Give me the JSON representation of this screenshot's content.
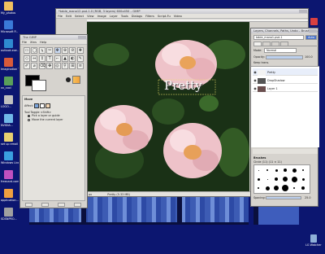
{
  "desktop": {
    "icons_left": [
      {
        "label": "My_photos"
      },
      {
        "label": "Microsoft P..."
      },
      {
        "label": "outlook.exe..."
      },
      {
        "label": "Imagination Thumbs"
      },
      {
        "label": "xx_cool"
      },
      {
        "label": "LOGO..."
      },
      {
        "label": "NVIDIA..."
      },
      {
        "label": "set up email for beginners"
      },
      {
        "label": "Windows Live..."
      },
      {
        "label": "freecard.com Windows ..."
      },
      {
        "label": "application..."
      },
      {
        "label": "SDSNPRO..."
      }
    ],
    "icons_right": [
      {
        "label": "..."
      },
      {
        "label": "..."
      },
      {
        "label": "..."
      },
      {
        "label": "..."
      },
      {
        "label": "..."
      },
      {
        "label": "..."
      }
    ],
    "recycle_label": "LG Watcher"
  },
  "image_window": {
    "title": "*table_mana12.psd-1.0 (RGB, 3 layers) 600x450 – GIMP",
    "menus": [
      "File",
      "Edit",
      "Select",
      "View",
      "Image",
      "Layer",
      "Tools",
      "Dialogs",
      "Filters",
      "Script-Fu",
      "Video"
    ],
    "canvas_text": "Pretty",
    "status": "px",
    "status_info": "Pretty (5.33 MB)"
  },
  "toolbox": {
    "title": "The GIMP",
    "menus": [
      "File",
      "Xtns",
      "Help"
    ],
    "tool_glyphs": [
      "▭",
      "◯",
      "ϡ",
      "✂",
      "✥",
      "⊕",
      "⊘",
      "✚",
      "◇",
      "⇔",
      "↕",
      "T",
      "⌐",
      "▲",
      "◐",
      "✎",
      "✐",
      "⌀",
      "⌫",
      "✤",
      "◎",
      "⚲",
      "⊞",
      "≡"
    ],
    "options_title": "Move",
    "affect_label": "Affect:",
    "toggle_label": "Tool Toggle  <Shift>",
    "option_pick": "Pick a layer or guide",
    "option_move": "Move the current layer"
  },
  "layers_dialog": {
    "title": "Layers, Channels, Paths, Undo – Brushes, ...",
    "image_select": "table_mana1.psd-1",
    "auto_label": "Auto",
    "mode_label": "Mode:",
    "mode_value": "Normal",
    "opacity_label": "Opacity:",
    "opacity_value": "100.0",
    "keep_trans_label": "Keep trans.",
    "layers": [
      {
        "name": "Pretty"
      },
      {
        "name": "DropShadow"
      },
      {
        "name": "Layer 1"
      }
    ],
    "brushes_title": "Brushes",
    "brush_name": "Circle (11) (11 × 11)",
    "spacing_label": "Spacing:",
    "spacing_value": "25.0"
  },
  "colors": {
    "desktop": "#0c1670",
    "taskbar_water": "#5b78c6",
    "canvas_bg": "#1e3a18",
    "rose": "#f2c9cf",
    "rose_center": "#e9a35a"
  }
}
